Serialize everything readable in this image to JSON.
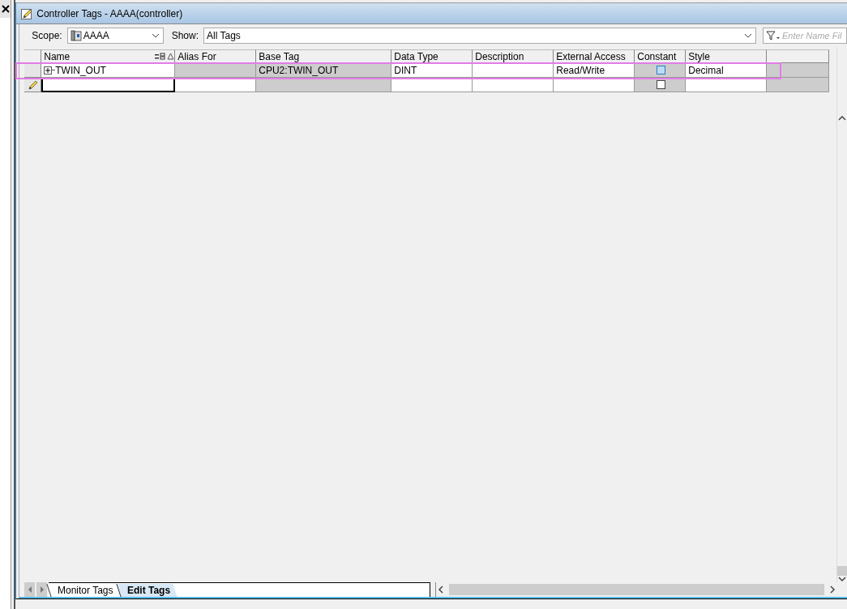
{
  "window": {
    "title": "Controller Tags - AAAA(controller)"
  },
  "toolbar": {
    "scope_label": "Scope:",
    "scope_value": "AAAA",
    "show_label": "Show:",
    "show_value": "All Tags",
    "filter_placeholder": "Enter Name Fil"
  },
  "table": {
    "columns": [
      "Name",
      "Alias For",
      "Base Tag",
      "Data Type",
      "Description",
      "External Access",
      "Constant",
      "Style"
    ],
    "rows": [
      {
        "kind": "tag",
        "expanded": false,
        "name": "TWIN_OUT",
        "base_tag": "CPU2:TWIN_OUT",
        "data_type": "DINT",
        "external_access": "Read/Write",
        "constant": false,
        "style": "Decimal"
      },
      {
        "kind": "new",
        "constant": false
      }
    ]
  },
  "tabs": [
    {
      "label": "Monitor Tags",
      "selected": false
    },
    {
      "label": "Edit Tags",
      "selected": true
    }
  ]
}
